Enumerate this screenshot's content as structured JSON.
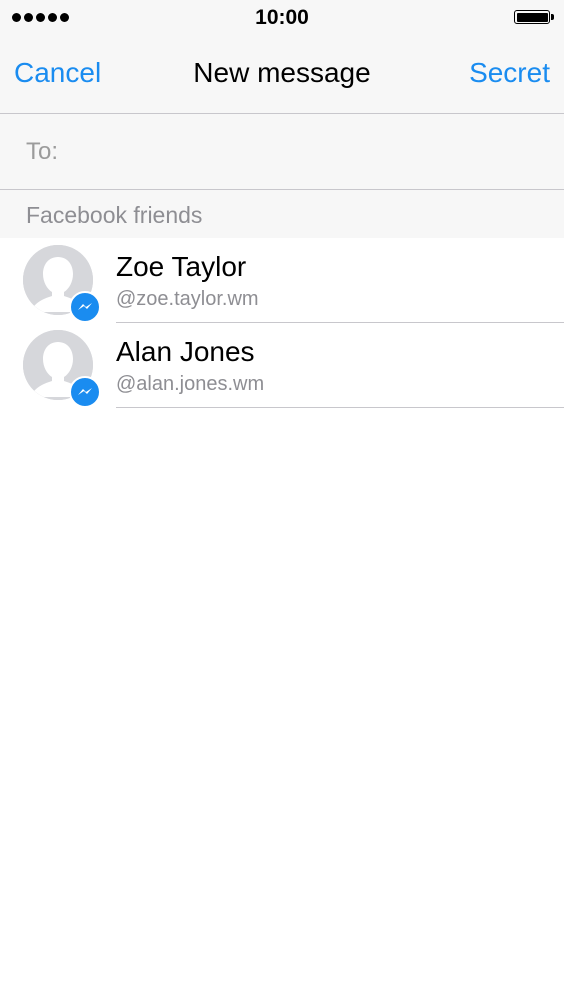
{
  "status_bar": {
    "time": "10:00",
    "signal_dots": 5,
    "battery_level": 1.0
  },
  "nav": {
    "cancel_label": "Cancel",
    "title": "New message",
    "secret_label": "Secret"
  },
  "to_field": {
    "label": "To:",
    "value": ""
  },
  "section": {
    "title": "Facebook friends"
  },
  "friends": [
    {
      "name": "Zoe Taylor",
      "handle": "@zoe.taylor.wm",
      "badge_icon": "messenger-icon",
      "avatar_icon": "default-avatar-icon"
    },
    {
      "name": "Alan Jones",
      "handle": "@alan.jones.wm",
      "badge_icon": "messenger-icon",
      "avatar_icon": "default-avatar-icon"
    }
  ],
  "colors": {
    "accent": "#1a8cf0",
    "bar_background": "#f7f7f7",
    "secondary_text": "#8e8e93"
  }
}
